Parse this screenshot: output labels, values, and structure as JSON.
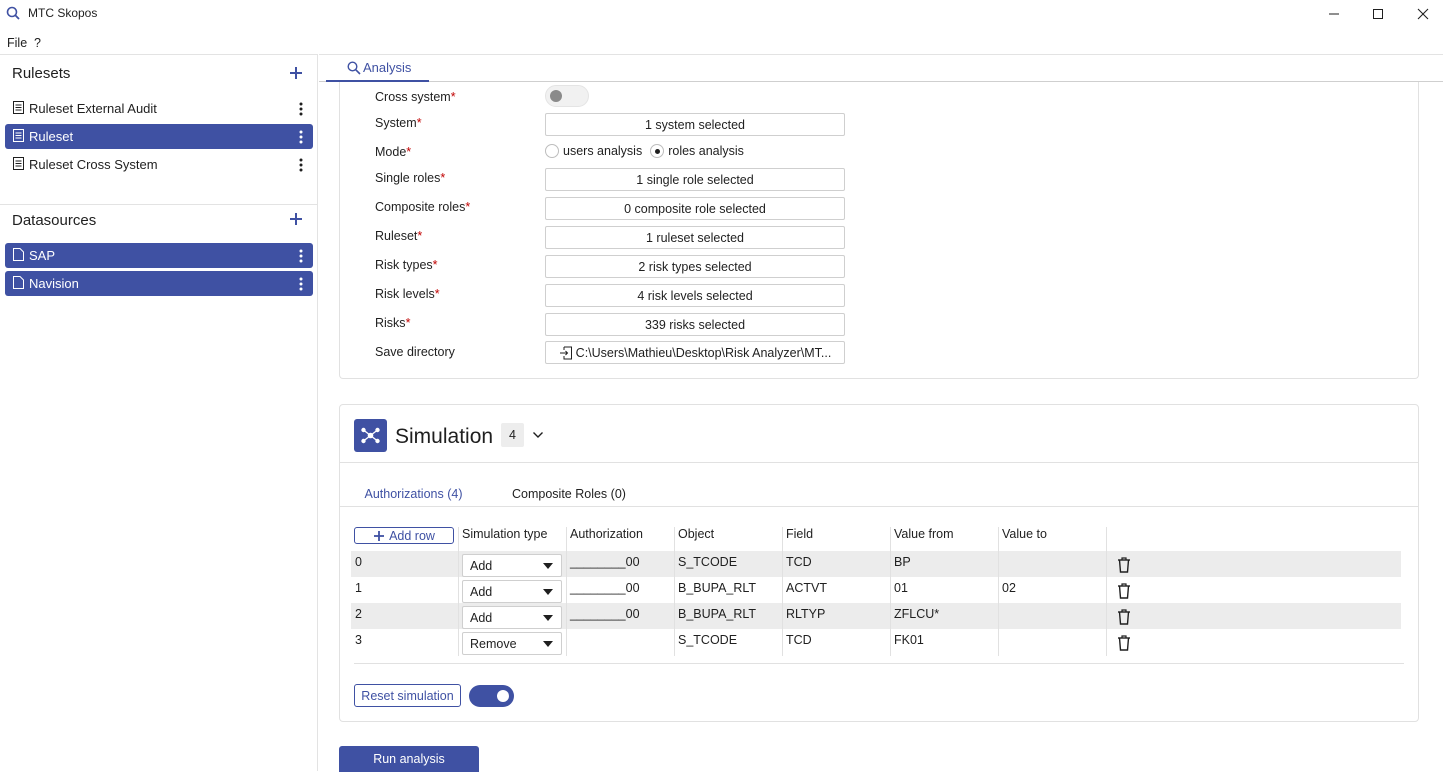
{
  "window": {
    "title": "MTC Skopos"
  },
  "menu": {
    "file": "File",
    "help": "?"
  },
  "sidebar": {
    "rulesets_title": "Rulesets",
    "rulesets": [
      {
        "label": "Ruleset External Audit"
      },
      {
        "label": "Ruleset"
      },
      {
        "label": "Ruleset Cross System"
      }
    ],
    "datasources_title": "Datasources",
    "datasources": [
      {
        "label": "SAP"
      },
      {
        "label": "Navision"
      }
    ]
  },
  "tabs": {
    "analysis": "Analysis"
  },
  "form": {
    "cross_system": "Cross system",
    "system": "System",
    "system_value": "1 system selected",
    "mode": "Mode",
    "mode_users": "users analysis",
    "mode_roles": "roles analysis",
    "single_roles": "Single roles",
    "single_roles_value": "1 single role selected",
    "composite_roles": "Composite roles",
    "composite_roles_value": "0 composite role selected",
    "ruleset": "Ruleset",
    "ruleset_value": "1 ruleset selected",
    "risk_types": "Risk types",
    "risk_types_value": "2 risk types selected",
    "risk_levels": "Risk levels",
    "risk_levels_value": "4 risk levels selected",
    "risks": "Risks",
    "risks_value": "339 risks selected",
    "save_directory": "Save directory",
    "save_directory_value": "C:\\Users\\Mathieu\\Desktop\\Risk Analyzer\\MT...",
    "required_mark": "*"
  },
  "simulation": {
    "title": "Simulation",
    "badge": "4",
    "tab_authorizations": "Authorizations (4)",
    "tab_composite": "Composite Roles (0)",
    "add_row": "Add row",
    "columns": [
      "Simulation type",
      "Authorization",
      "Object",
      "Field",
      "Value from",
      "Value to"
    ],
    "rows": [
      {
        "index": "0",
        "type": "Add",
        "authorization": "________00",
        "object": "S_TCODE",
        "field": "TCD",
        "value_from": "BP",
        "value_to": ""
      },
      {
        "index": "1",
        "type": "Add",
        "authorization": "________00",
        "object": "B_BUPA_RLT",
        "field": "ACTVT",
        "value_from": "01",
        "value_to": "02"
      },
      {
        "index": "2",
        "type": "Add",
        "authorization": "________00",
        "object": "B_BUPA_RLT",
        "field": "RLTYP",
        "value_from": "ZFLCU*",
        "value_to": ""
      },
      {
        "index": "3",
        "type": "Remove",
        "authorization": "",
        "object": "S_TCODE",
        "field": "TCD",
        "value_from": "FK01",
        "value_to": ""
      }
    ],
    "reset": "Reset simulation"
  },
  "actions": {
    "run": "Run analysis"
  },
  "colors": {
    "accent": "#3f51a3",
    "required": "#c00000"
  }
}
